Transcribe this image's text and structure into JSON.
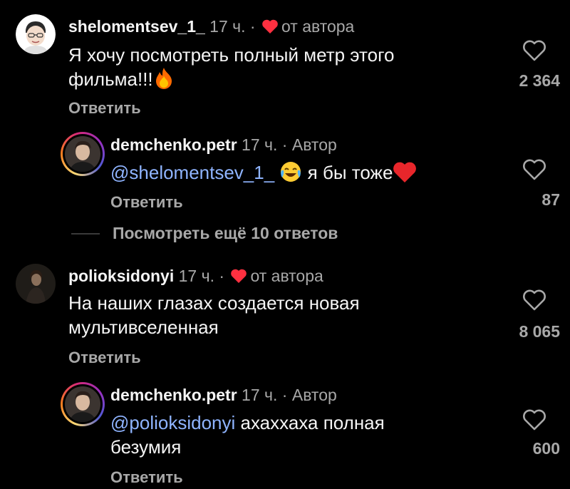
{
  "colors": {
    "background": "#000000",
    "text": "#f5f5f5",
    "secondary": "#a8a8a8",
    "mention": "#8fb4ff",
    "heart": "#ff3040"
  },
  "comments": [
    {
      "username": "shelomentsev_1_",
      "time": "17 ч.",
      "dot": "·",
      "tag": "от автора",
      "text": "Я хочу посмотреть полный метр этого фильма!!!",
      "emoji": "fire-emoji",
      "reply_label": "Ответить",
      "likes": "2 364"
    },
    {
      "username": "demchenko.petr",
      "time": "17 ч.",
      "dot": "·",
      "tag": "Автор",
      "mention": "@shelomentsev_1_",
      "text": "я бы тоже",
      "emoji_before": "laughing-emoji",
      "emoji_after": "red-heart-emoji",
      "reply_label": "Ответить",
      "likes": "87"
    },
    {
      "username": "polioksidonyi",
      "time": "17 ч.",
      "dot": "·",
      "tag": "от автора",
      "text_line1": "На наших глазах создается новая",
      "text_line2": "мультивселенная",
      "reply_label": "Ответить",
      "likes": "8 065"
    },
    {
      "username": "demchenko.petr",
      "time": "17 ч.",
      "dot": "·",
      "tag": "Автор",
      "mention": "@polioksidonyi",
      "text_line1": "ахаххаха полная",
      "text_line2": "безумия",
      "reply_label": "Ответить",
      "likes": "600"
    }
  ],
  "view_more": {
    "label": "Посмотреть ещё 10 ответов"
  },
  "icons": {
    "like": "heart-outline-icon",
    "author_like": "heart-filled-icon"
  }
}
